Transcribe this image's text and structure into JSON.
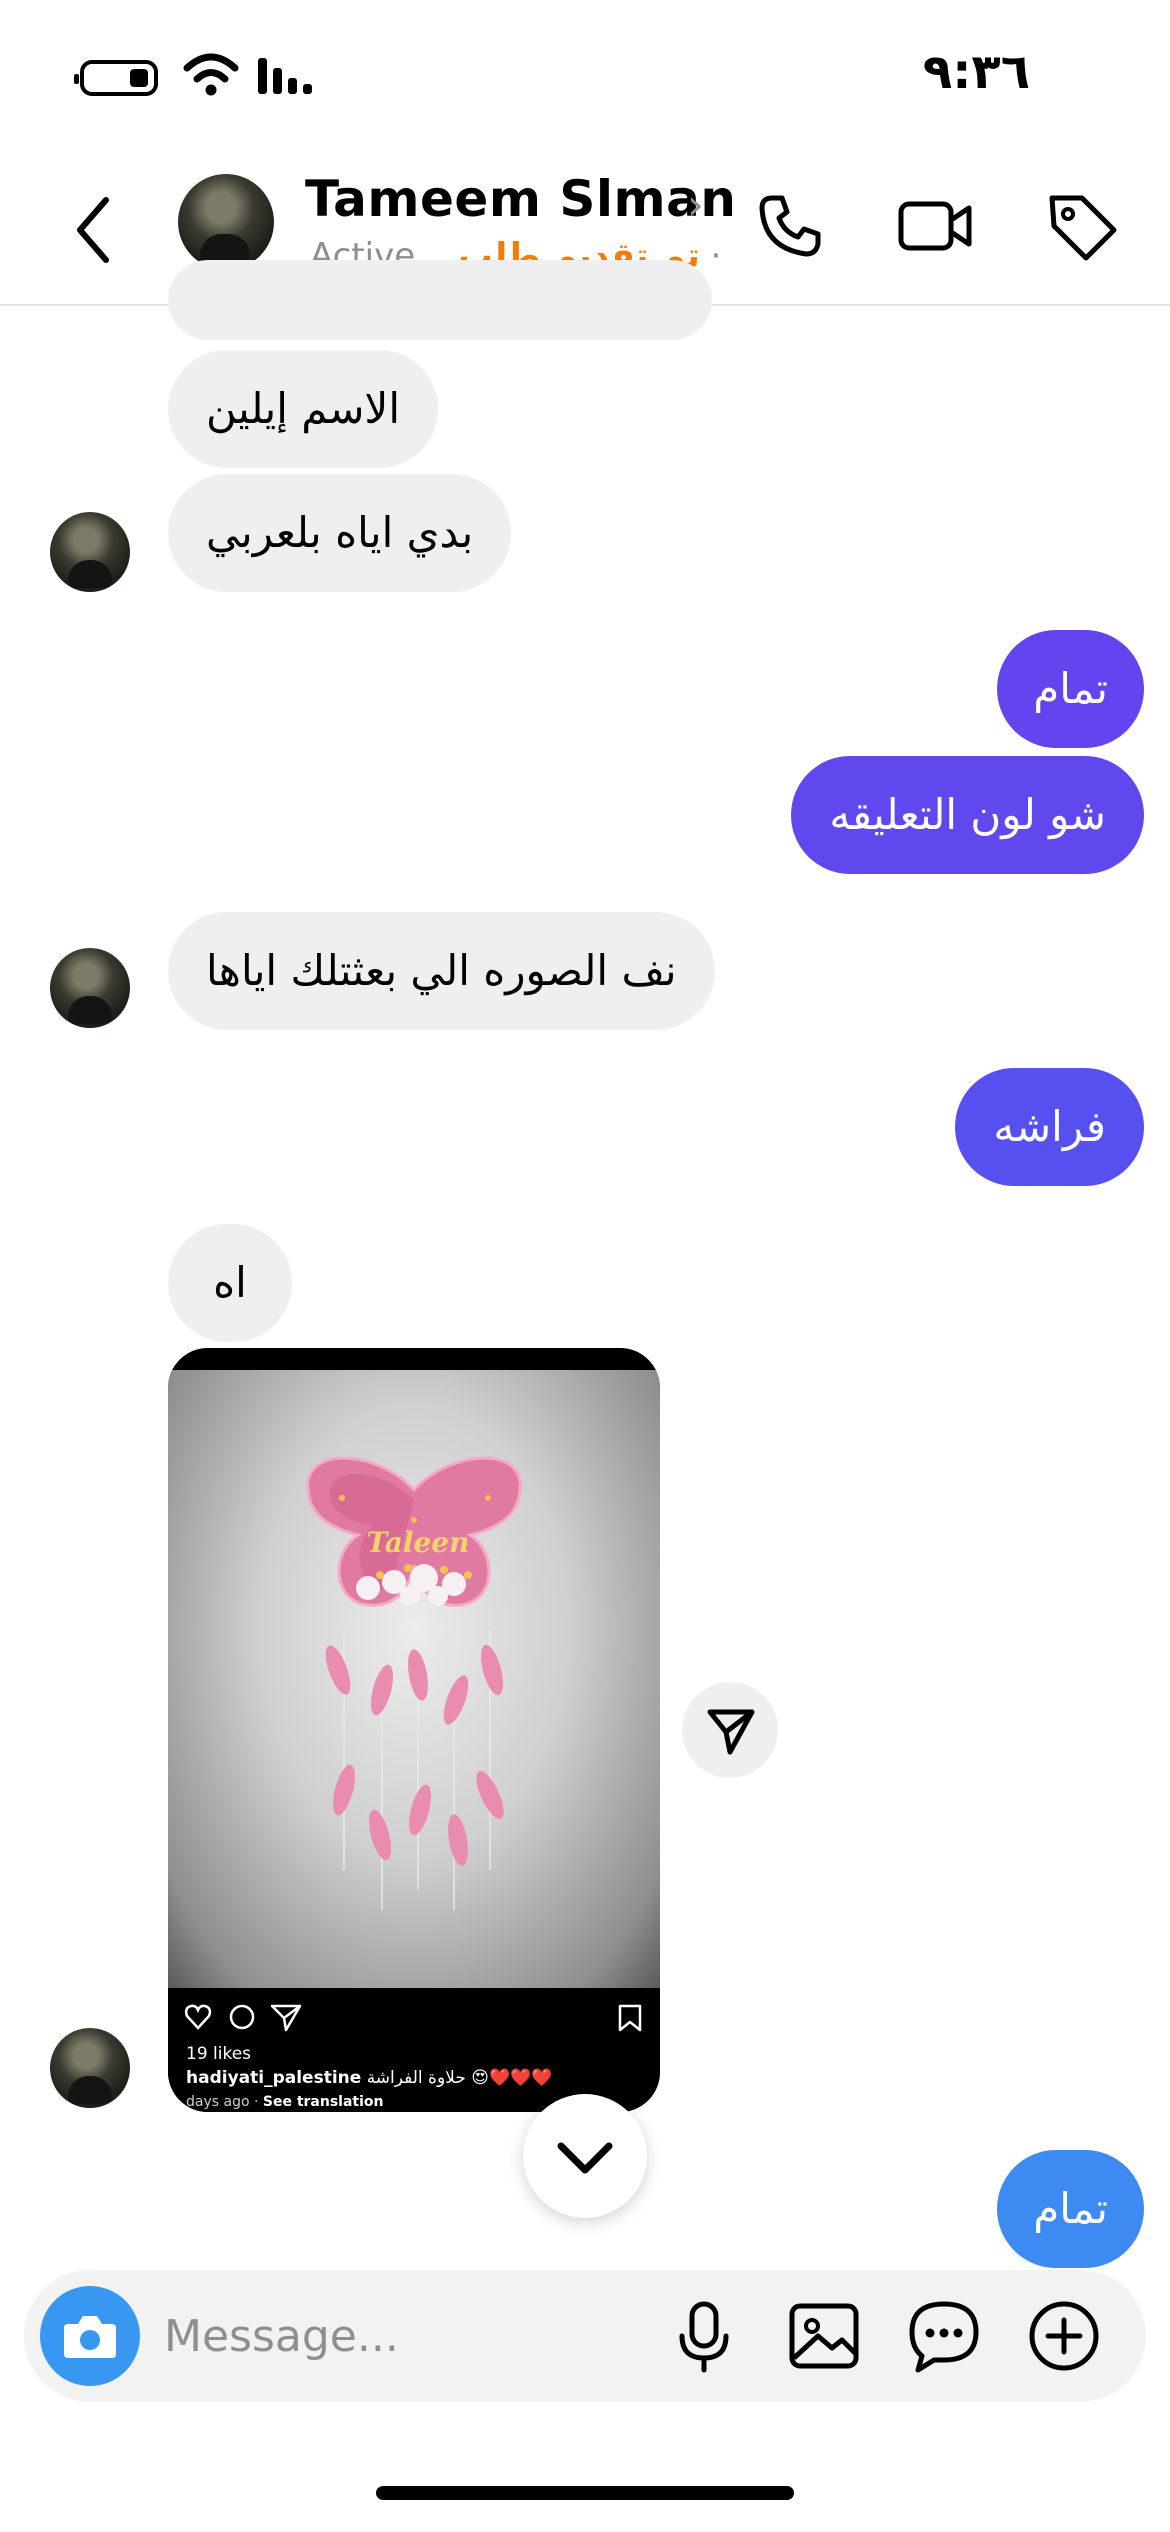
{
  "status_bar": {
    "time": "٩:٣٦"
  },
  "header": {
    "contact_name": "Tameem Slman",
    "request_status": "تم تقديم طلب",
    "separator": "·",
    "activity": "Active..."
  },
  "messages": [
    {
      "direction": "in",
      "text": "الاسم إيلين"
    },
    {
      "direction": "in",
      "text": "بدي اياه بلعربي"
    },
    {
      "direction": "out",
      "text": "تمام"
    },
    {
      "direction": "out",
      "text": "شو لون التعليقه"
    },
    {
      "direction": "in",
      "text": "نف الصوره الي بعثتلك اياها"
    },
    {
      "direction": "out",
      "text": "فراشه"
    },
    {
      "direction": "in",
      "text": "اه"
    },
    {
      "direction": "out",
      "text": "تمام"
    }
  ],
  "shared_post": {
    "image_text": "Taleen",
    "likes": "19 likes",
    "username": "hadiyati_palestine",
    "caption": "حلاوة الفراشة 😍❤️❤️❤️",
    "time_ago": "days ago",
    "translate": "See translation"
  },
  "composer": {
    "placeholder": "Message..."
  },
  "colors": {
    "outgoing_bubble": "#5B4CF0",
    "outgoing_bubble_last": "#3D8BF2",
    "incoming_bubble": "#EFEFEF",
    "request_status": "#F57C00",
    "camera_button": "#3897F0",
    "butterfly_pink": "#E07AA3"
  }
}
